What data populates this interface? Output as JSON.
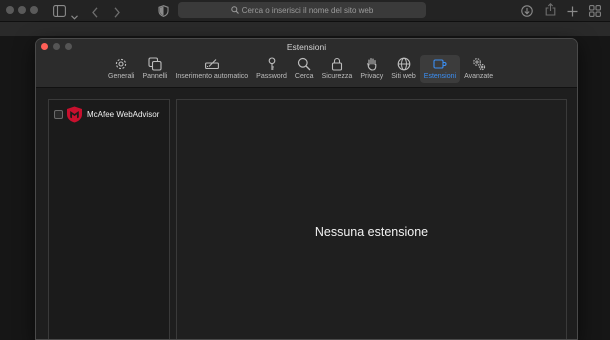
{
  "browser": {
    "address_placeholder": "Cerca o inserisci il nome del sito web"
  },
  "window": {
    "title": "Estensioni"
  },
  "tabs": [
    {
      "label": "Generali",
      "icon": "gear-icon"
    },
    {
      "label": "Pannelli",
      "icon": "tabs-icon"
    },
    {
      "label": "Inserimento automatico",
      "icon": "autofill-icon"
    },
    {
      "label": "Password",
      "icon": "key-icon"
    },
    {
      "label": "Cerca",
      "icon": "search-icon"
    },
    {
      "label": "Sicurezza",
      "icon": "lock-icon"
    },
    {
      "label": "Privacy",
      "icon": "hand-icon"
    },
    {
      "label": "Siti web",
      "icon": "globe-icon"
    },
    {
      "label": "Estensioni",
      "icon": "puzzle-icon",
      "active": true
    },
    {
      "label": "Avanzate",
      "icon": "gears-icon"
    }
  ],
  "sidebar": {
    "extensions": [
      {
        "name": "McAfee WebAdvisor",
        "checked": false
      }
    ]
  },
  "main": {
    "empty_message": "Nessuna estensione"
  },
  "colors": {
    "accent": "#3b8ff5",
    "mcafee_red": "#c8102e"
  }
}
